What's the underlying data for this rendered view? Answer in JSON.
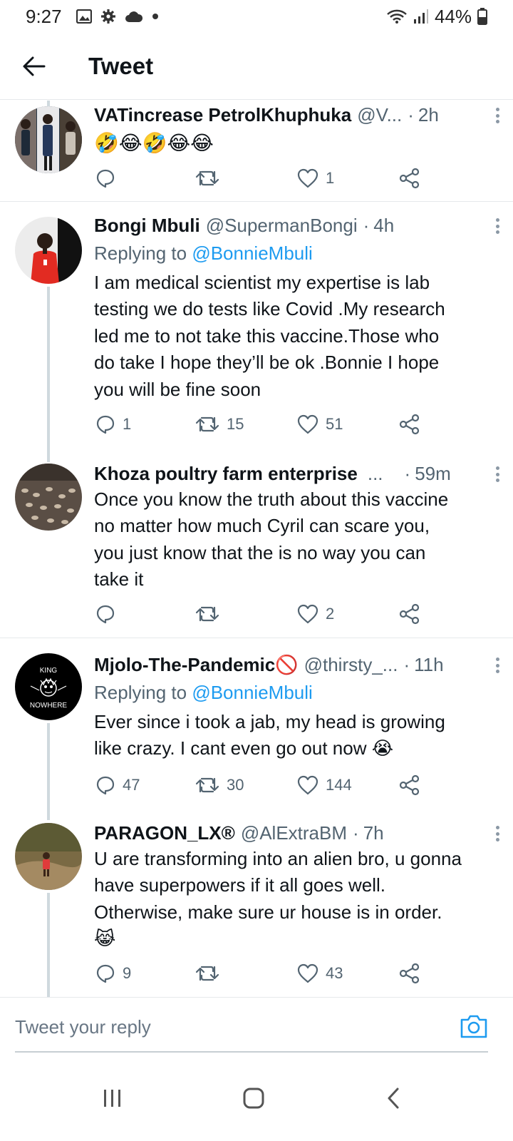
{
  "status_bar": {
    "time": "9:27",
    "battery": "44%",
    "icons": [
      "gallery-icon",
      "settings-icon",
      "cloud-icon",
      "dot-icon",
      "wifi-icon",
      "signal-icon",
      "battery-icon"
    ]
  },
  "header": {
    "title": "Tweet",
    "back_icon": "arrow-left-icon"
  },
  "tweets": [
    {
      "name": "VATincrease PetrolKhuphuka",
      "handle": "@V...",
      "time": "2h",
      "text": "🤣😂🤣😂😂",
      "replying_to": "",
      "replies": "",
      "retweets": "",
      "likes": "1"
    },
    {
      "name": "Bongi Mbuli",
      "handle": "@SupermanBongi",
      "time": "4h",
      "replying_prefix": "Replying to",
      "replying_to": "@BonnieMbuli",
      "text": "I am medical scientist my expertise is lab\ntesting we do tests like Covid .My research\nled me to not take this vaccine.Those who\ndo take I hope they’ll be ok .Bonnie I hope\nyou will be fine soon",
      "replies": "1",
      "retweets": "15",
      "likes": "51"
    },
    {
      "name": "Khoza poultry farm enterprise",
      "handle": "...",
      "time": "59m",
      "text": "Once you know the truth about this vaccine\nno matter how much Cyril can scare you,\nyou just know that the is no way you can\ntake it",
      "replies": "",
      "retweets": "",
      "likes": "2"
    },
    {
      "name": "Mjolo-The-Pandemic🚫",
      "handle": "@thirsty_...",
      "time": "11h",
      "replying_prefix": "Replying to",
      "replying_to": "@BonnieMbuli",
      "text": "Ever since i took a jab, my head is growing\nlike crazy. I cant even go out now 😭",
      "replies": "47",
      "retweets": "30",
      "likes": "144",
      "avatar_text_top": "KING",
      "avatar_text_bottom": "NOWHERE"
    },
    {
      "name": "PARAGON_LX®",
      "handle": "@AlExtraBM",
      "time": "7h",
      "text": "U are transforming into an alien bro, u gonna\nhave superpowers if it all goes well.\nOtherwise, make sure ur house is in order.\n😹",
      "replies": "9",
      "retweets": "",
      "likes": "43"
    }
  ],
  "reply_bar": {
    "placeholder": "Tweet your reply",
    "camera_icon": "camera-icon"
  },
  "nav_bar": {
    "icons": [
      "recent-apps-icon",
      "home-icon",
      "back-icon"
    ]
  },
  "colors": {
    "accent": "#1d9bf0",
    "secondary_text": "#536471",
    "divider": "#e6e9eb"
  }
}
